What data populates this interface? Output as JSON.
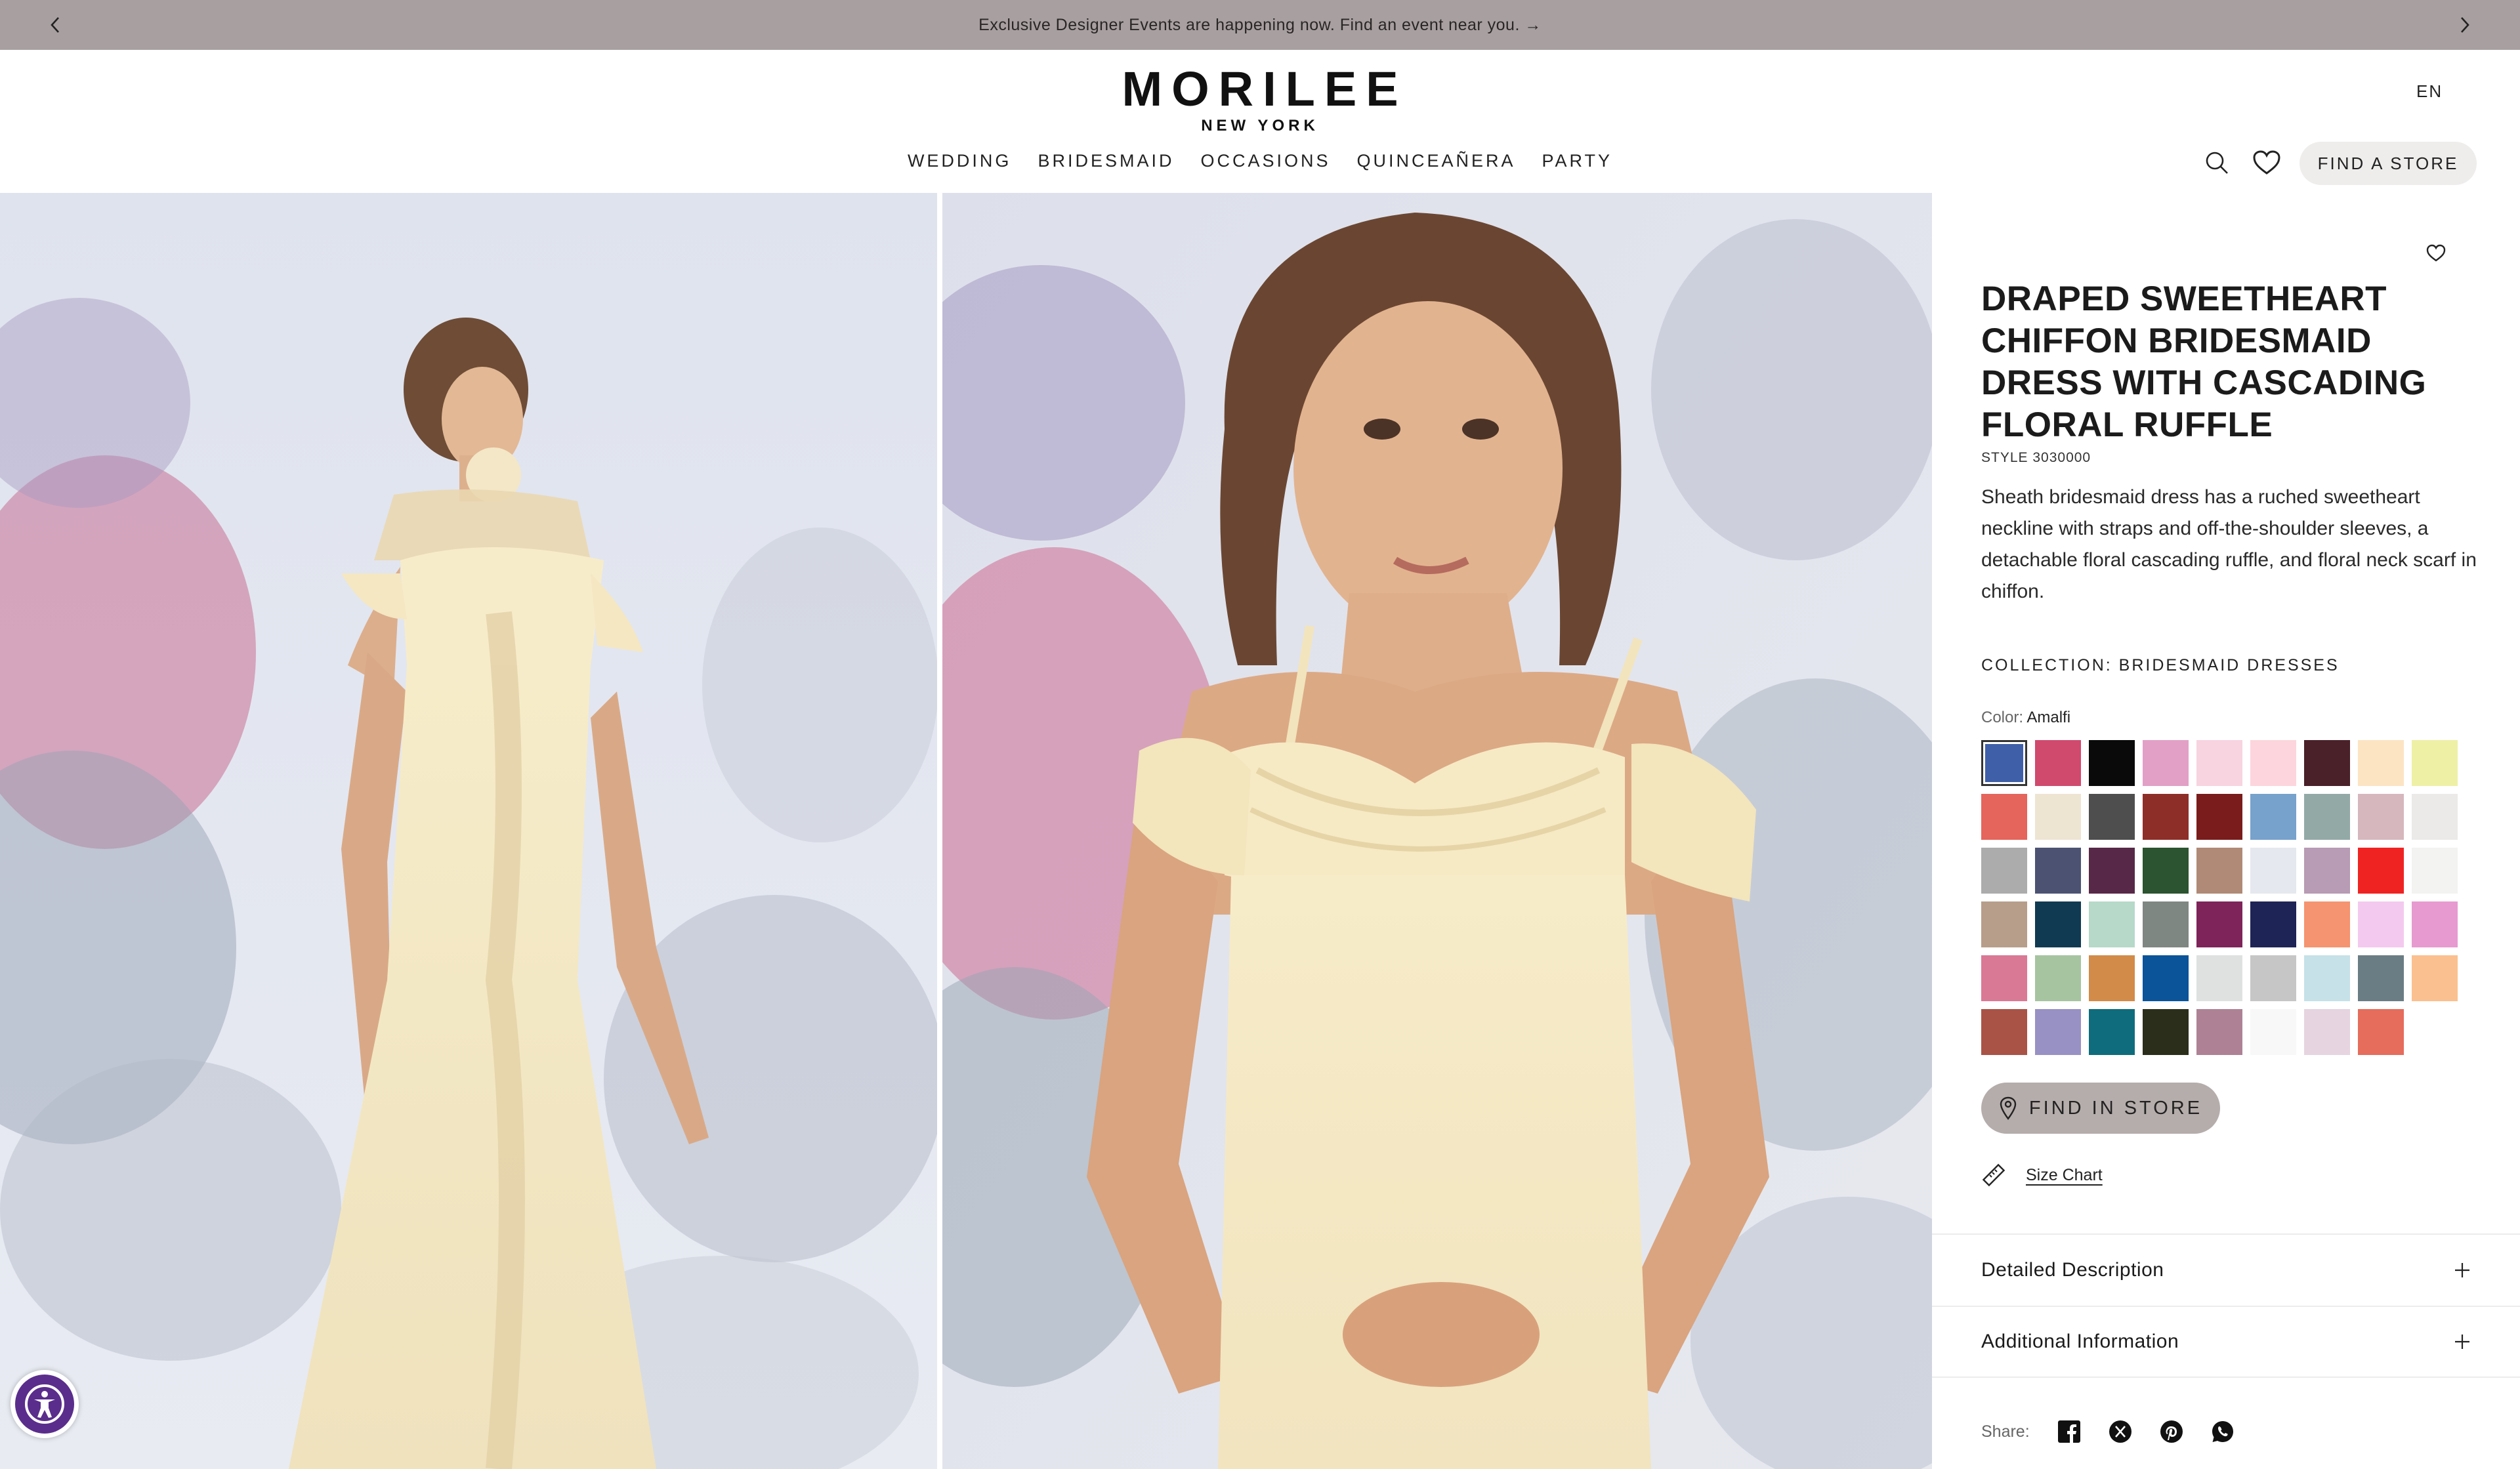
{
  "announcement": {
    "message": "Exclusive Designer Events are happening now. Find an event near you. →",
    "prev_icon": "chevron-left-icon",
    "next_icon": "chevron-right-icon"
  },
  "header": {
    "brand": "MORILEE",
    "brand_sub": "NEW YORK",
    "language": "EN",
    "nav": [
      "WEDDING",
      "BRIDESMAID",
      "OCCASIONS",
      "QUINCEAÑERA",
      "PARTY"
    ],
    "icons": [
      "search-icon",
      "heart-icon"
    ],
    "find_store_label": "FIND A STORE"
  },
  "product": {
    "title": "DRAPED SWEETHEART CHIFFON BRIDESMAID DRESS WITH CASCADING FLORAL RUFFLE",
    "style": "STYLE 3030000",
    "description": "Sheath bridesmaid dress has a ruched sweetheart neckline with straps and off-the-shoulder sleeves, a detachable floral cascading ruffle, and floral neck scarf in chiffon.",
    "collection": "COLLECTION: BRIDESMAID DRESSES",
    "color_label": "Color:",
    "color_value": "Amalfi",
    "swatches": [
      "#3f5fa8",
      "#d04a6e",
      "#0a0a0a",
      "#e2a0c6",
      "#f8d3e0",
      "#fcd6dc",
      "#4a2029",
      "#fce4c3",
      "#eef0a6",
      "#e5645c",
      "#eee4d2",
      "#4e4e4e",
      "#8e2e28",
      "#7a1c1c",
      "#76a2cc",
      "#93a9a6",
      "#d5b7bd",
      "#ece9e9",
      "#acacac",
      "#4c5372",
      "#582848",
      "#2c5430",
      "#b08a76",
      "#e5e8ef",
      "#b89bb5",
      "#f02323",
      "#f3f3f1",
      "#b79e8a",
      "#103a52",
      "#b6d9c9",
      "#7f8783",
      "#7e245a",
      "#1f2456",
      "#f59470",
      "#f4c9ef",
      "#e79ad0",
      "#d97995",
      "#a6c4a0",
      "#d28b48",
      "#0b5499",
      "#dee1e0",
      "#c6c6c6",
      "#c6e1e8",
      "#6b7d84",
      "#fbc08f",
      "#a95347",
      "#9891c4",
      "#0f6c7c",
      "#2c2e1c",
      "#ae8294",
      "#f9f8f8",
      "#e6d4e0",
      "#e66c5c"
    ],
    "selected_swatch": 0,
    "find_in_store_label": "FIND IN STORE",
    "size_chart_label": "Size Chart",
    "accordions": [
      "Detailed Description",
      "Additional Information"
    ],
    "share_label": "Share:",
    "share_icons": [
      "facebook-icon",
      "x-icon",
      "pinterest-icon",
      "whatsapp-icon"
    ]
  }
}
